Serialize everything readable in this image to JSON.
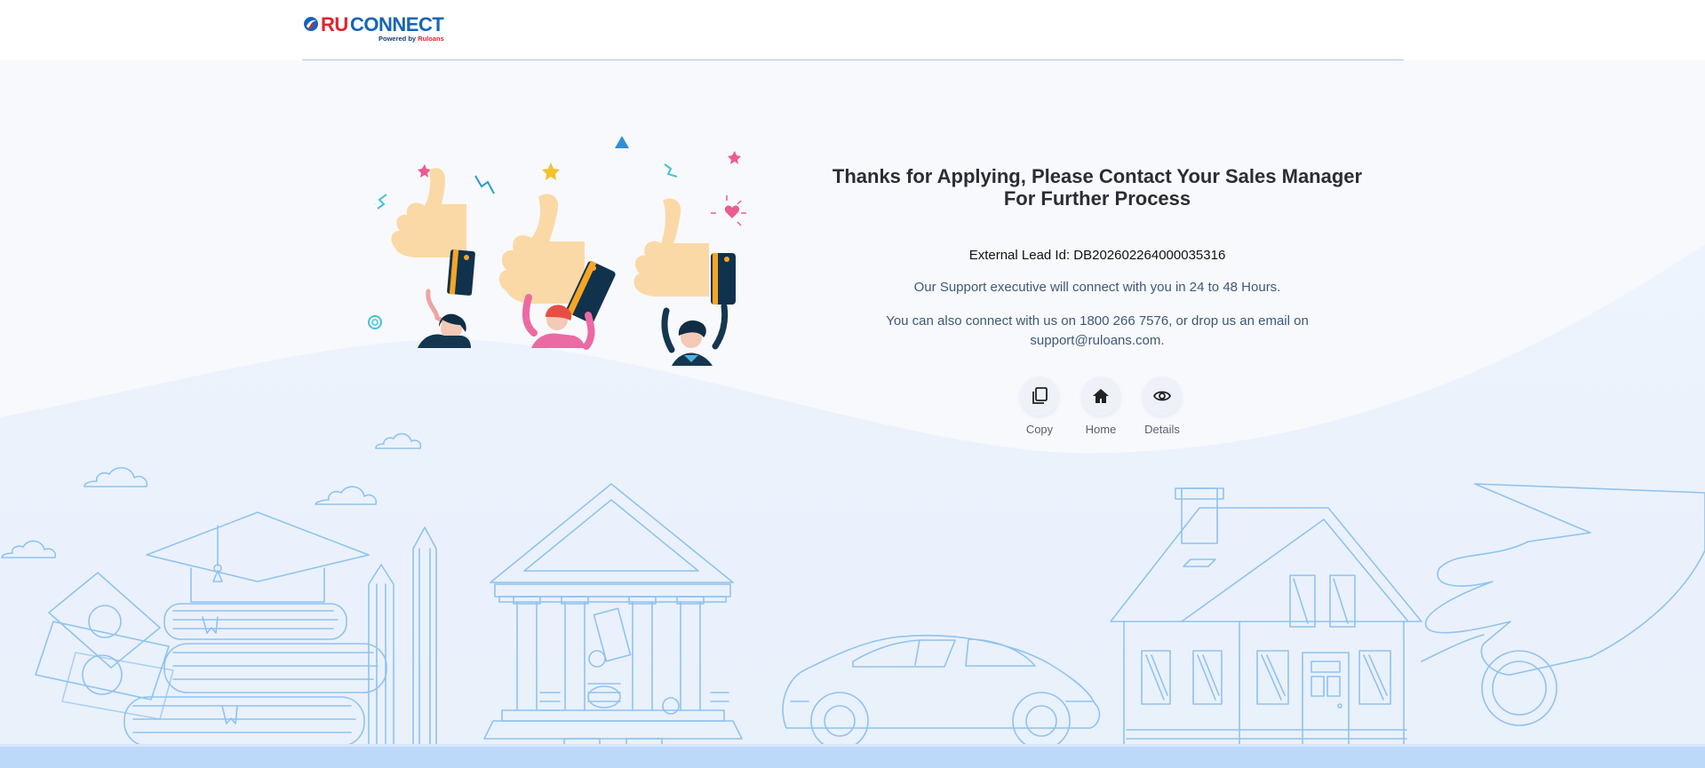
{
  "brand": {
    "ru": "RU",
    "connect": "CONNECT",
    "powered_by": "Powered by ",
    "powered_brand": "Ruloans"
  },
  "message": {
    "title_line1": "Thanks for Applying, Please Contact Your Sales Manager",
    "title_line2": "For Further Process",
    "lead_label": "External Lead Id: ",
    "lead_id": "DB202602264000035316",
    "support_text": "Our Support executive will connect with you in 24 to 48 Hours.",
    "contact_text": "You can also connect with us on 1800 266 7576, or drop us an email on support@ruloans.com."
  },
  "actions": [
    {
      "label": "Copy",
      "icon": "copy-icon"
    },
    {
      "label": "Home",
      "icon": "home-icon"
    },
    {
      "label": "Details",
      "icon": "eye-icon"
    }
  ],
  "colors": {
    "brand_red": "#e1232b",
    "brand_blue": "#1565b6",
    "line_art": "#8fc3ef",
    "band": "#bdd9f9"
  }
}
